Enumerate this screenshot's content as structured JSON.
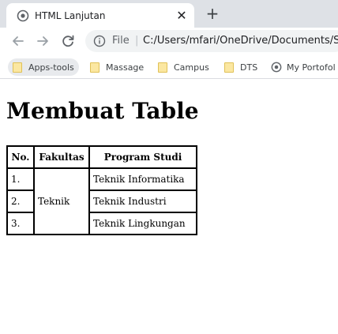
{
  "browser": {
    "tab": {
      "title": "HTML Lanjutan",
      "close_glyph": "✕",
      "favicon": "globe-icon"
    },
    "new_tab_glyph": "+",
    "toolbar": {
      "back_icon": "arrow-left-icon",
      "forward_icon": "arrow-right-icon",
      "reload_icon": "reload-icon",
      "omnibox": {
        "info_icon": "info-icon",
        "scheme": "File",
        "separator": "|",
        "url": "C:/Users/mfari/OneDrive/Documents/Se"
      }
    },
    "bookmarks": [
      {
        "label": "Apps-tools",
        "icon": "folder-icon"
      },
      {
        "label": "Massage",
        "icon": "folder-icon"
      },
      {
        "label": "Campus",
        "icon": "folder-icon"
      },
      {
        "label": "DTS",
        "icon": "folder-icon"
      },
      {
        "label": "My Portofol",
        "icon": "globe-icon"
      }
    ]
  },
  "page": {
    "title": "Membuat Table",
    "table": {
      "headers": [
        "No.",
        "Fakultas",
        "Program Studi"
      ],
      "rows": [
        {
          "no": "1.",
          "program": "Teknik Informatika"
        },
        {
          "no": "2.",
          "program": "Teknik Industri"
        },
        {
          "no": "3.",
          "program": "Teknik Lingkungan"
        }
      ],
      "fakultas_merged": "Teknik"
    }
  },
  "colors": {
    "tabstrip_bg": "#dee1e6",
    "omnibox_bg": "#f1f3f4",
    "folder_fill": "#fbe7a1",
    "border": "#000000"
  }
}
